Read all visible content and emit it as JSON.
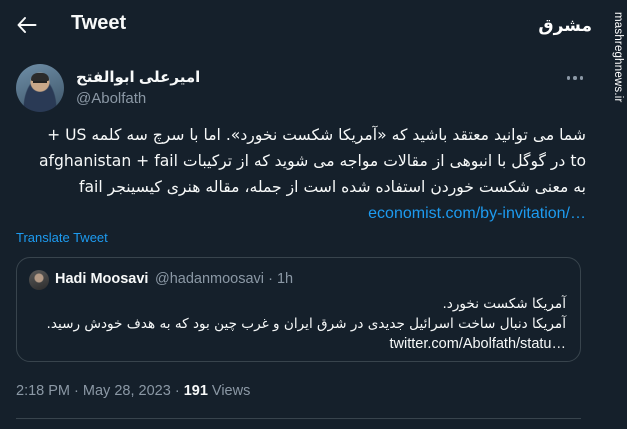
{
  "header": {
    "title": "Tweet",
    "back_icon": "arrow-left-icon"
  },
  "author": {
    "name": "امیرعلی ابوالفتح",
    "handle": "@Abolfath",
    "more_icon": "more-horizontal-icon"
  },
  "tweet": {
    "lines": [
      "شما می توانید معتقد باشید که «آمریکا شکست نخورد». اما با سرچ سه کلمه US +",
      "afghanistan + fail در گوگل با انبوهی از مقالات مواجه می شوید که از ترکیبات to",
      "fail به معنی شکست خوردن استفاده شده است از جمله، مقاله هنری کیسینجر"
    ],
    "link": "economist.com/by-invitation/…",
    "translate_label": "Translate Tweet"
  },
  "quote": {
    "name": "Hadi Moosavi",
    "handle": "@hadanmoosavi",
    "separator": "·",
    "age": "1h",
    "lines": [
      "آمریکا شکست نخورد.",
      "آمریکا دنبال ساخت اسرائیل جدیدی در شرق ایران و غرب چین بود که به هدف خودش رسید."
    ],
    "link": "twitter.com/Abolfath/statu…"
  },
  "meta": {
    "time": "2:18 PM",
    "separator": "·",
    "date": "May 28, 2023",
    "views_count": "191",
    "views_label": "Views"
  },
  "watermark": {
    "logo": "مشرق",
    "site": "mashreghnews.ir"
  },
  "colors": {
    "background": "#15202b",
    "text": "#f7f9f9",
    "muted": "#8b98a5",
    "accent": "#1d9bf0",
    "border": "#38444d"
  }
}
